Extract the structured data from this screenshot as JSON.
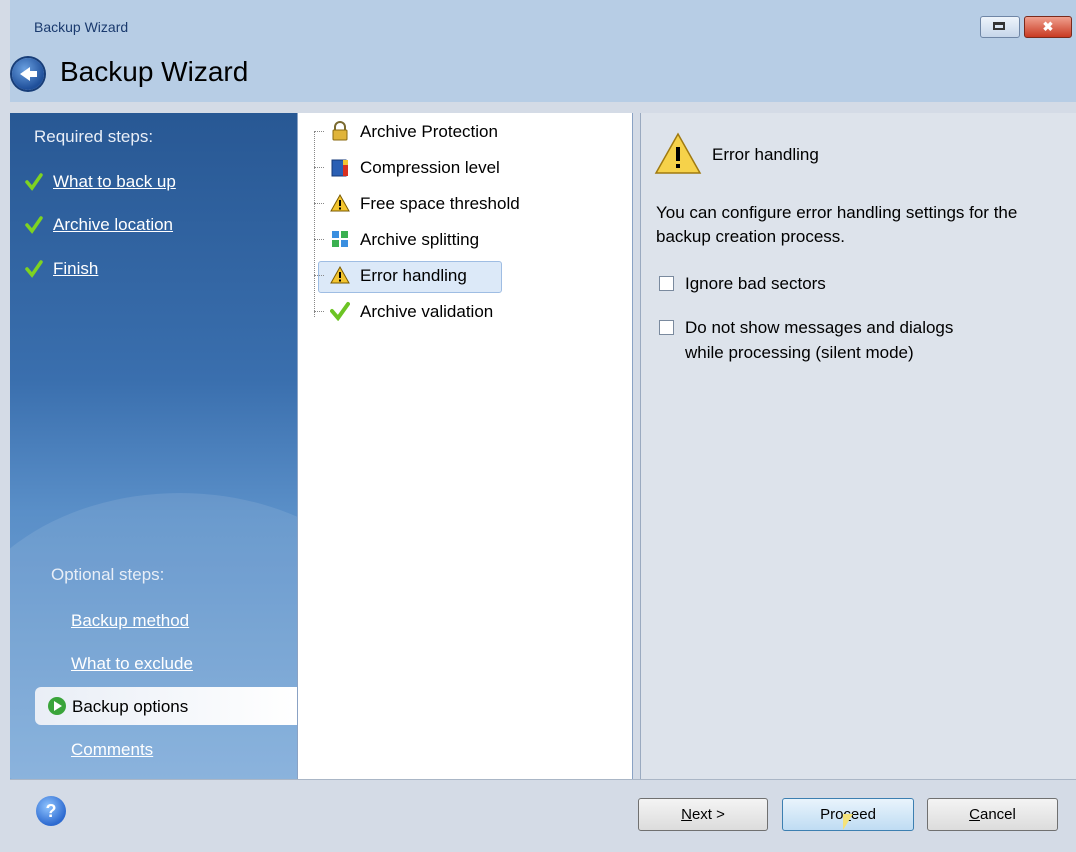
{
  "window": {
    "title": "Backup Wizard",
    "heading": "Backup Wizard",
    "close_glyph": "✖"
  },
  "sidebar": {
    "required_heading": "Required steps:",
    "required_items": [
      {
        "label": "What to back up"
      },
      {
        "label": "Archive location"
      },
      {
        "label": "Finish"
      }
    ],
    "optional_heading": "Optional steps:",
    "optional_items": [
      {
        "label": "Backup method"
      },
      {
        "label": "What to exclude"
      },
      {
        "label": "Backup options"
      },
      {
        "label": "Comments"
      }
    ],
    "active_item": "Backup options"
  },
  "tree": {
    "items": [
      {
        "label": "Archive Protection",
        "icon": "lock-icon"
      },
      {
        "label": "Compression level",
        "icon": "compression-icon"
      },
      {
        "label": "Free space threshold",
        "icon": "warning-icon"
      },
      {
        "label": "Archive splitting",
        "icon": "split-icon"
      },
      {
        "label": "Error handling",
        "icon": "warning-icon"
      },
      {
        "label": "Archive validation",
        "icon": "checkmark-icon"
      }
    ],
    "selected": "Error handling"
  },
  "panel": {
    "title": "Error handling",
    "description": "You can configure error handling settings for the backup creation process.",
    "options": [
      {
        "label": "Ignore bad sectors",
        "checked": false
      },
      {
        "label_line1": "Do not show messages and dialogs",
        "label_line2": "while processing (silent mode)",
        "checked": false
      }
    ]
  },
  "footer": {
    "help_glyph": "?",
    "next_label_underlined": "N",
    "next_label_rest": "ext >",
    "proceed_label_pre": "Pro",
    "proceed_label_underlined": "c",
    "proceed_label_rest": "eed",
    "cancel_label_underlined": "C",
    "cancel_label_rest": "ancel"
  }
}
